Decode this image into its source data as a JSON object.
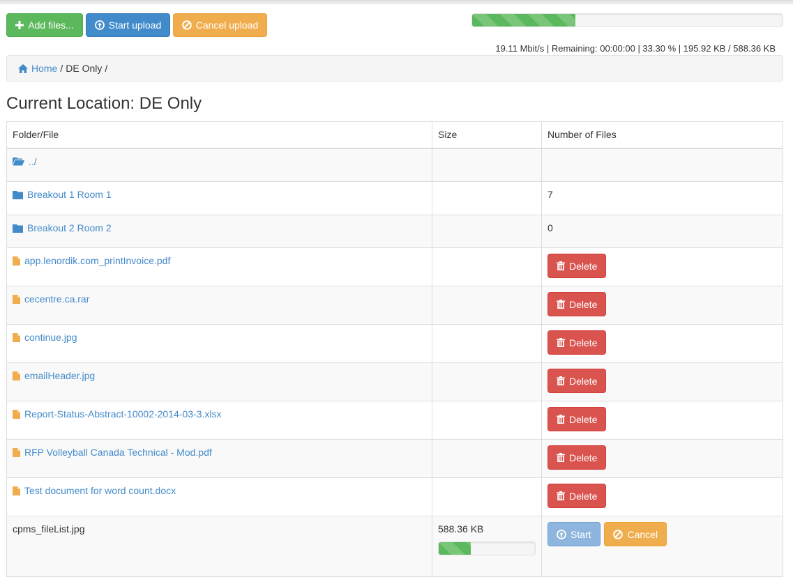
{
  "toolbar": {
    "add_files": "Add files...",
    "start_upload": "Start upload",
    "cancel_upload": "Cancel upload"
  },
  "upload_status": {
    "progress_fraction": 0.333,
    "text": "19.11 Mbit/s | Remaining: 00:00:00 | 33.30 % | 195.92 KB / 588.36 KB"
  },
  "breadcrumb": {
    "home": "Home",
    "current": "DE Only",
    "separator": "/"
  },
  "page_title": "Current Location: DE Only",
  "table": {
    "headers": [
      "Folder/File",
      "Size",
      "Number of Files"
    ],
    "parent_link": "../",
    "folders": [
      {
        "name": "Breakout 1 Room 1",
        "count": "7"
      },
      {
        "name": "Breakout 2 Room 2",
        "count": "0"
      }
    ],
    "files": [
      {
        "name": "app.lenordik.com_printInvoice.pdf",
        "action": "Delete"
      },
      {
        "name": "cecentre.ca.rar",
        "action": "Delete"
      },
      {
        "name": "continue.jpg",
        "action": "Delete"
      },
      {
        "name": "emailHeader.jpg",
        "action": "Delete"
      },
      {
        "name": "Report-Status-Abstract-10002-2014-03-3.xlsx",
        "action": "Delete"
      },
      {
        "name": "RFP Volleyball Canada Technical - Mod.pdf",
        "action": "Delete"
      },
      {
        "name": "Test document for word count.docx",
        "action": "Delete"
      }
    ],
    "pending": {
      "name": "cpms_fileList.jpg",
      "size": "588.36 KB",
      "progress_fraction": 0.333,
      "start_label": "Start",
      "cancel_label": "Cancel"
    }
  },
  "colors": {
    "success": "#5cb85c",
    "primary": "#428bca",
    "warning": "#f0ad4e",
    "danger": "#d9534f",
    "file_icon": "#f0ad4e"
  }
}
